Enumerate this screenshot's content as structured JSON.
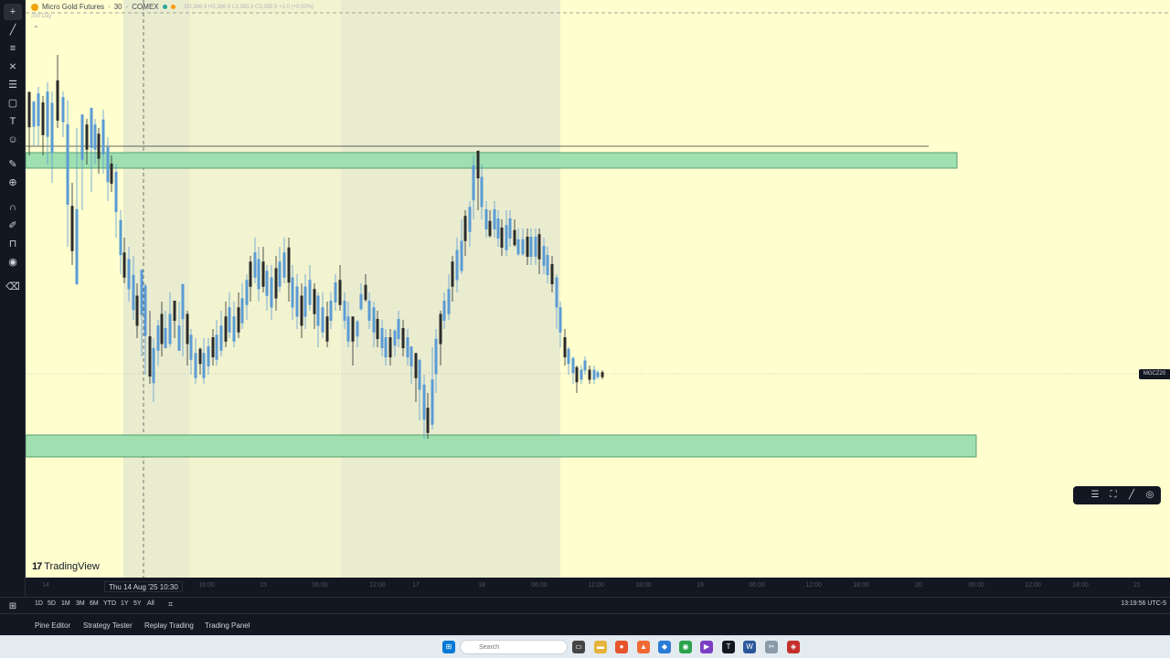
{
  "symbol": {
    "name": "Micro Gold Futures",
    "interval": "30",
    "exchange": "COMEX",
    "ohlc_text": "O3,386.9 H3,386.9 L3,385.3 C3,385.9 +1.0 (+0.03%)",
    "sub_legend": "200 Day"
  },
  "price_tag": "MGCZ20",
  "brand": "TradingView",
  "crosshair_time": "Thu 14 Aug '25  10:30",
  "time_ticks": [
    "14",
    "18:00",
    "15",
    "06:00",
    "12:00",
    "17",
    "18",
    "06:00",
    "12:00",
    "18:00",
    "19",
    "06:00",
    "12:00",
    "18:00",
    "20",
    "06:00",
    "12:00",
    "18:00",
    "21"
  ],
  "ranges": [
    "1D",
    "5D",
    "1M",
    "3M",
    "6M",
    "YTD",
    "1Y",
    "5Y",
    "All"
  ],
  "clock": "13:19:56 UTC-5",
  "bottom_tabs": [
    "Pine Editor",
    "Strategy Tester",
    "Replay Trading",
    "Trading Panel"
  ],
  "taskbar": {
    "search_placeholder": "Search"
  },
  "colors": {
    "background": "#fefecf",
    "session_shade": "#e9eccf",
    "zone_fill": "#9fdfb0",
    "up_candle": "#5b9bd5",
    "down_candle": "#2b2b2b"
  },
  "icons": [
    "cursor-icon",
    "trend-line-icon",
    "fib-icon",
    "pattern-icon",
    "forecast-icon",
    "shape-icon",
    "text-icon",
    "emoji-icon",
    "ruler-icon",
    "zoom-icon",
    "magnet-icon",
    "lock-icon",
    "eye-icon",
    "trash-icon"
  ]
}
